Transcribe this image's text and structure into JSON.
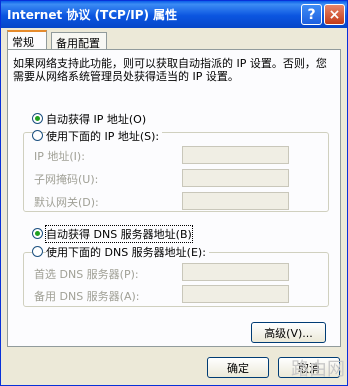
{
  "window": {
    "title": "Internet 协议 (TCP/IP) 属性",
    "help_glyph": "?",
    "close_glyph": "×"
  },
  "tabs": [
    {
      "label": "常规",
      "active": true
    },
    {
      "label": "备用配置",
      "active": false
    }
  ],
  "description": "如果网络支持此功能，则可以获取自动指派的 IP 设置。否则，您需要从网络系统管理员处获得适当的 IP 设置。",
  "ip": {
    "auto_label": "自动获得 IP 地址(O)",
    "manual_label": "使用下面的 IP 地址(S):",
    "selected": "auto",
    "fields": [
      {
        "label": "IP 地址(I):",
        "value": ""
      },
      {
        "label": "子网掩码(U):",
        "value": ""
      },
      {
        "label": "默认网关(D):",
        "value": ""
      }
    ]
  },
  "dns": {
    "auto_label": "自动获得 DNS 服务器地址(B)",
    "manual_label": "使用下面的 DNS 服务器地址(E):",
    "selected": "auto",
    "fields": [
      {
        "label": "首选 DNS 服务器(P):",
        "value": ""
      },
      {
        "label": "备用 DNS 服务器(A):",
        "value": ""
      }
    ]
  },
  "buttons": {
    "advanced": "高级(V)...",
    "ok": "确定",
    "cancel": "取消"
  },
  "watermark": "路由网"
}
